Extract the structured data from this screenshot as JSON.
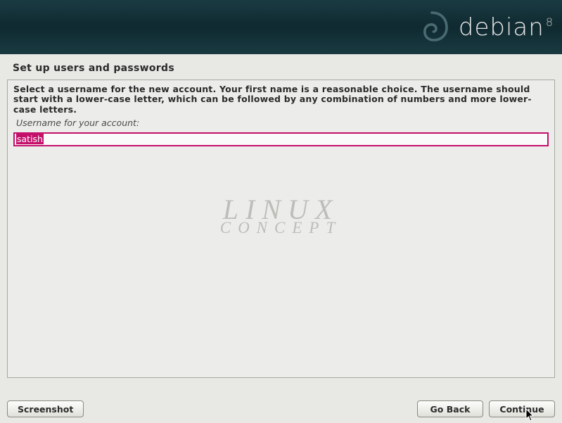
{
  "header": {
    "brand": "debian",
    "version": "8"
  },
  "page": {
    "title": "Set up users and passwords"
  },
  "main": {
    "instruction": "Select a username for the new account. Your first name is a reasonable choice. The username should start with a lower-case letter, which can be followed by any combination of numbers and more lower-case letters.",
    "field_label": "Username for your account:",
    "username_value": "satish"
  },
  "watermark": {
    "line1": "LINUX",
    "line2": "CONCEPT"
  },
  "buttons": {
    "screenshot": "Screenshot",
    "go_back": "Go Back",
    "continue": "Continue"
  }
}
